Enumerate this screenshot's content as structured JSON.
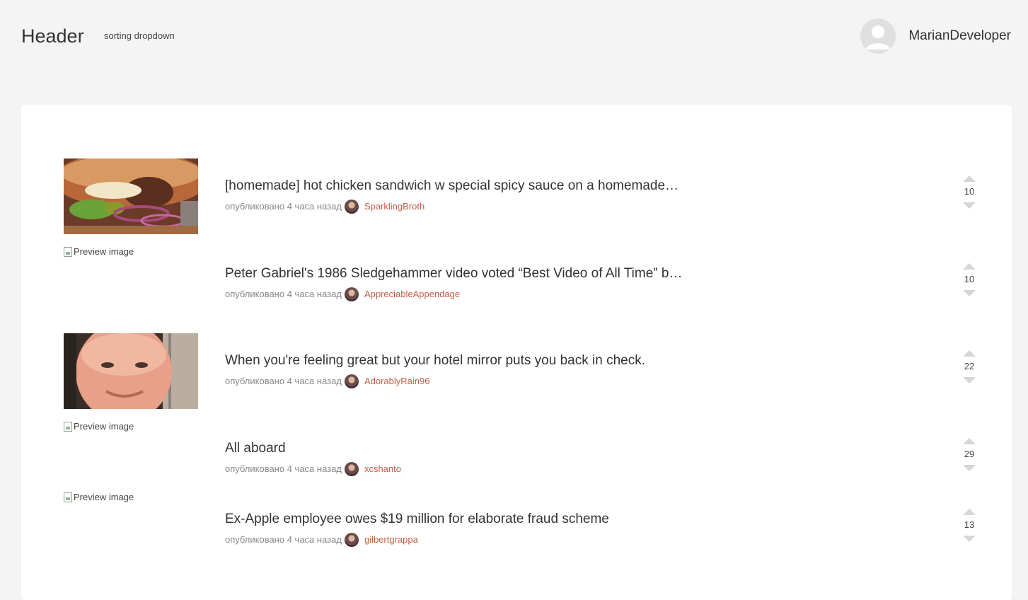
{
  "header": {
    "title": "Header",
    "sort_label": "sorting dropdown",
    "user_name": "MarianDeveloper"
  },
  "colors": {
    "background": "#f4f4f4",
    "card": "#ffffff",
    "author_link": "#c0604a",
    "meta_text": "#888888",
    "vote_arrow": "#d6d6d6"
  },
  "posts": [
    {
      "title": "[homemade] hot chicken sandwich w special spicy sauce on a homemade…",
      "meta_prefix": "опубликовано 4 часа назад",
      "author": "SparklingBroth",
      "score": "10",
      "image_alt": "",
      "image": "burger"
    },
    {
      "title": "Peter Gabriel's 1986 Sledgehammer video voted “Best Video of All Time” b…",
      "meta_prefix": "опубликовано 4 часа назад",
      "author": "AppreciableAppendage",
      "score": "10",
      "image_alt": "Preview image",
      "image": "broken"
    },
    {
      "title": "When you're feeling great but your hotel mirror puts you back in check.",
      "meta_prefix": "опубликовано 4 часа назад",
      "author": "AdorablyRain96",
      "score": "22",
      "image_alt": "",
      "image": "face"
    },
    {
      "title": "All aboard",
      "meta_prefix": "опубликовано 4 часа назад",
      "author": "xcshanto",
      "score": "29",
      "image_alt": "Preview image",
      "image": "broken"
    },
    {
      "title": "Ex-Apple employee owes $19 million for elaborate fraud scheme",
      "meta_prefix": "опубликовано 4 часа назад",
      "author": "gilbertgrappa",
      "score": "13",
      "image_alt": "Preview image",
      "image": "broken"
    }
  ]
}
